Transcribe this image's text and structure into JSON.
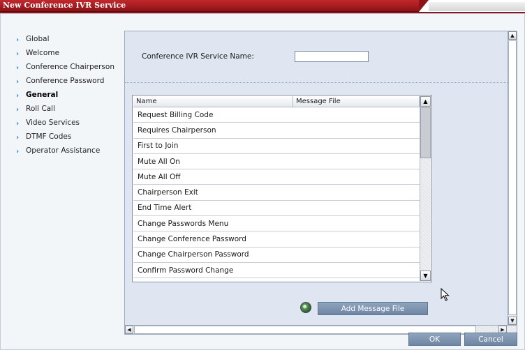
{
  "window": {
    "title": "New Conference IVR Service"
  },
  "sidebar": {
    "items": [
      {
        "label": "Global",
        "active": false
      },
      {
        "label": "Welcome",
        "active": false
      },
      {
        "label": "Conference Chairperson",
        "active": false
      },
      {
        "label": "Conference Password",
        "active": false
      },
      {
        "label": "General",
        "active": true
      },
      {
        "label": "Roll Call",
        "active": false
      },
      {
        "label": "Video Services",
        "active": false
      },
      {
        "label": "DTMF Codes",
        "active": false
      },
      {
        "label": "Operator Assistance",
        "active": false
      }
    ],
    "arrow_icon": "chevron-right-icon"
  },
  "form": {
    "service_name_label": "Conference IVR Service Name:",
    "service_name_value": ""
  },
  "table": {
    "columns": [
      "Name",
      "Message File"
    ],
    "rows": [
      {
        "name": "Request Billing Code",
        "message_file": ""
      },
      {
        "name": "Requires Chairperson",
        "message_file": ""
      },
      {
        "name": "First to Join",
        "message_file": ""
      },
      {
        "name": "Mute All On",
        "message_file": ""
      },
      {
        "name": "Mute All Off",
        "message_file": ""
      },
      {
        "name": "Chairperson Exit",
        "message_file": ""
      },
      {
        "name": "End Time Alert",
        "message_file": ""
      },
      {
        "name": "Change Passwords Menu",
        "message_file": ""
      },
      {
        "name": "Change Conference Password",
        "message_file": ""
      },
      {
        "name": "Change Chairperson Password",
        "message_file": ""
      },
      {
        "name": "Confirm Password Change",
        "message_file": ""
      }
    ]
  },
  "actions": {
    "add_message_file": "Add Message File",
    "ok": "OK",
    "cancel": "Cancel"
  },
  "colors": {
    "title_bar": "#b01e22",
    "accent_button": "#7d93af",
    "panel": "#dfe6f1"
  }
}
